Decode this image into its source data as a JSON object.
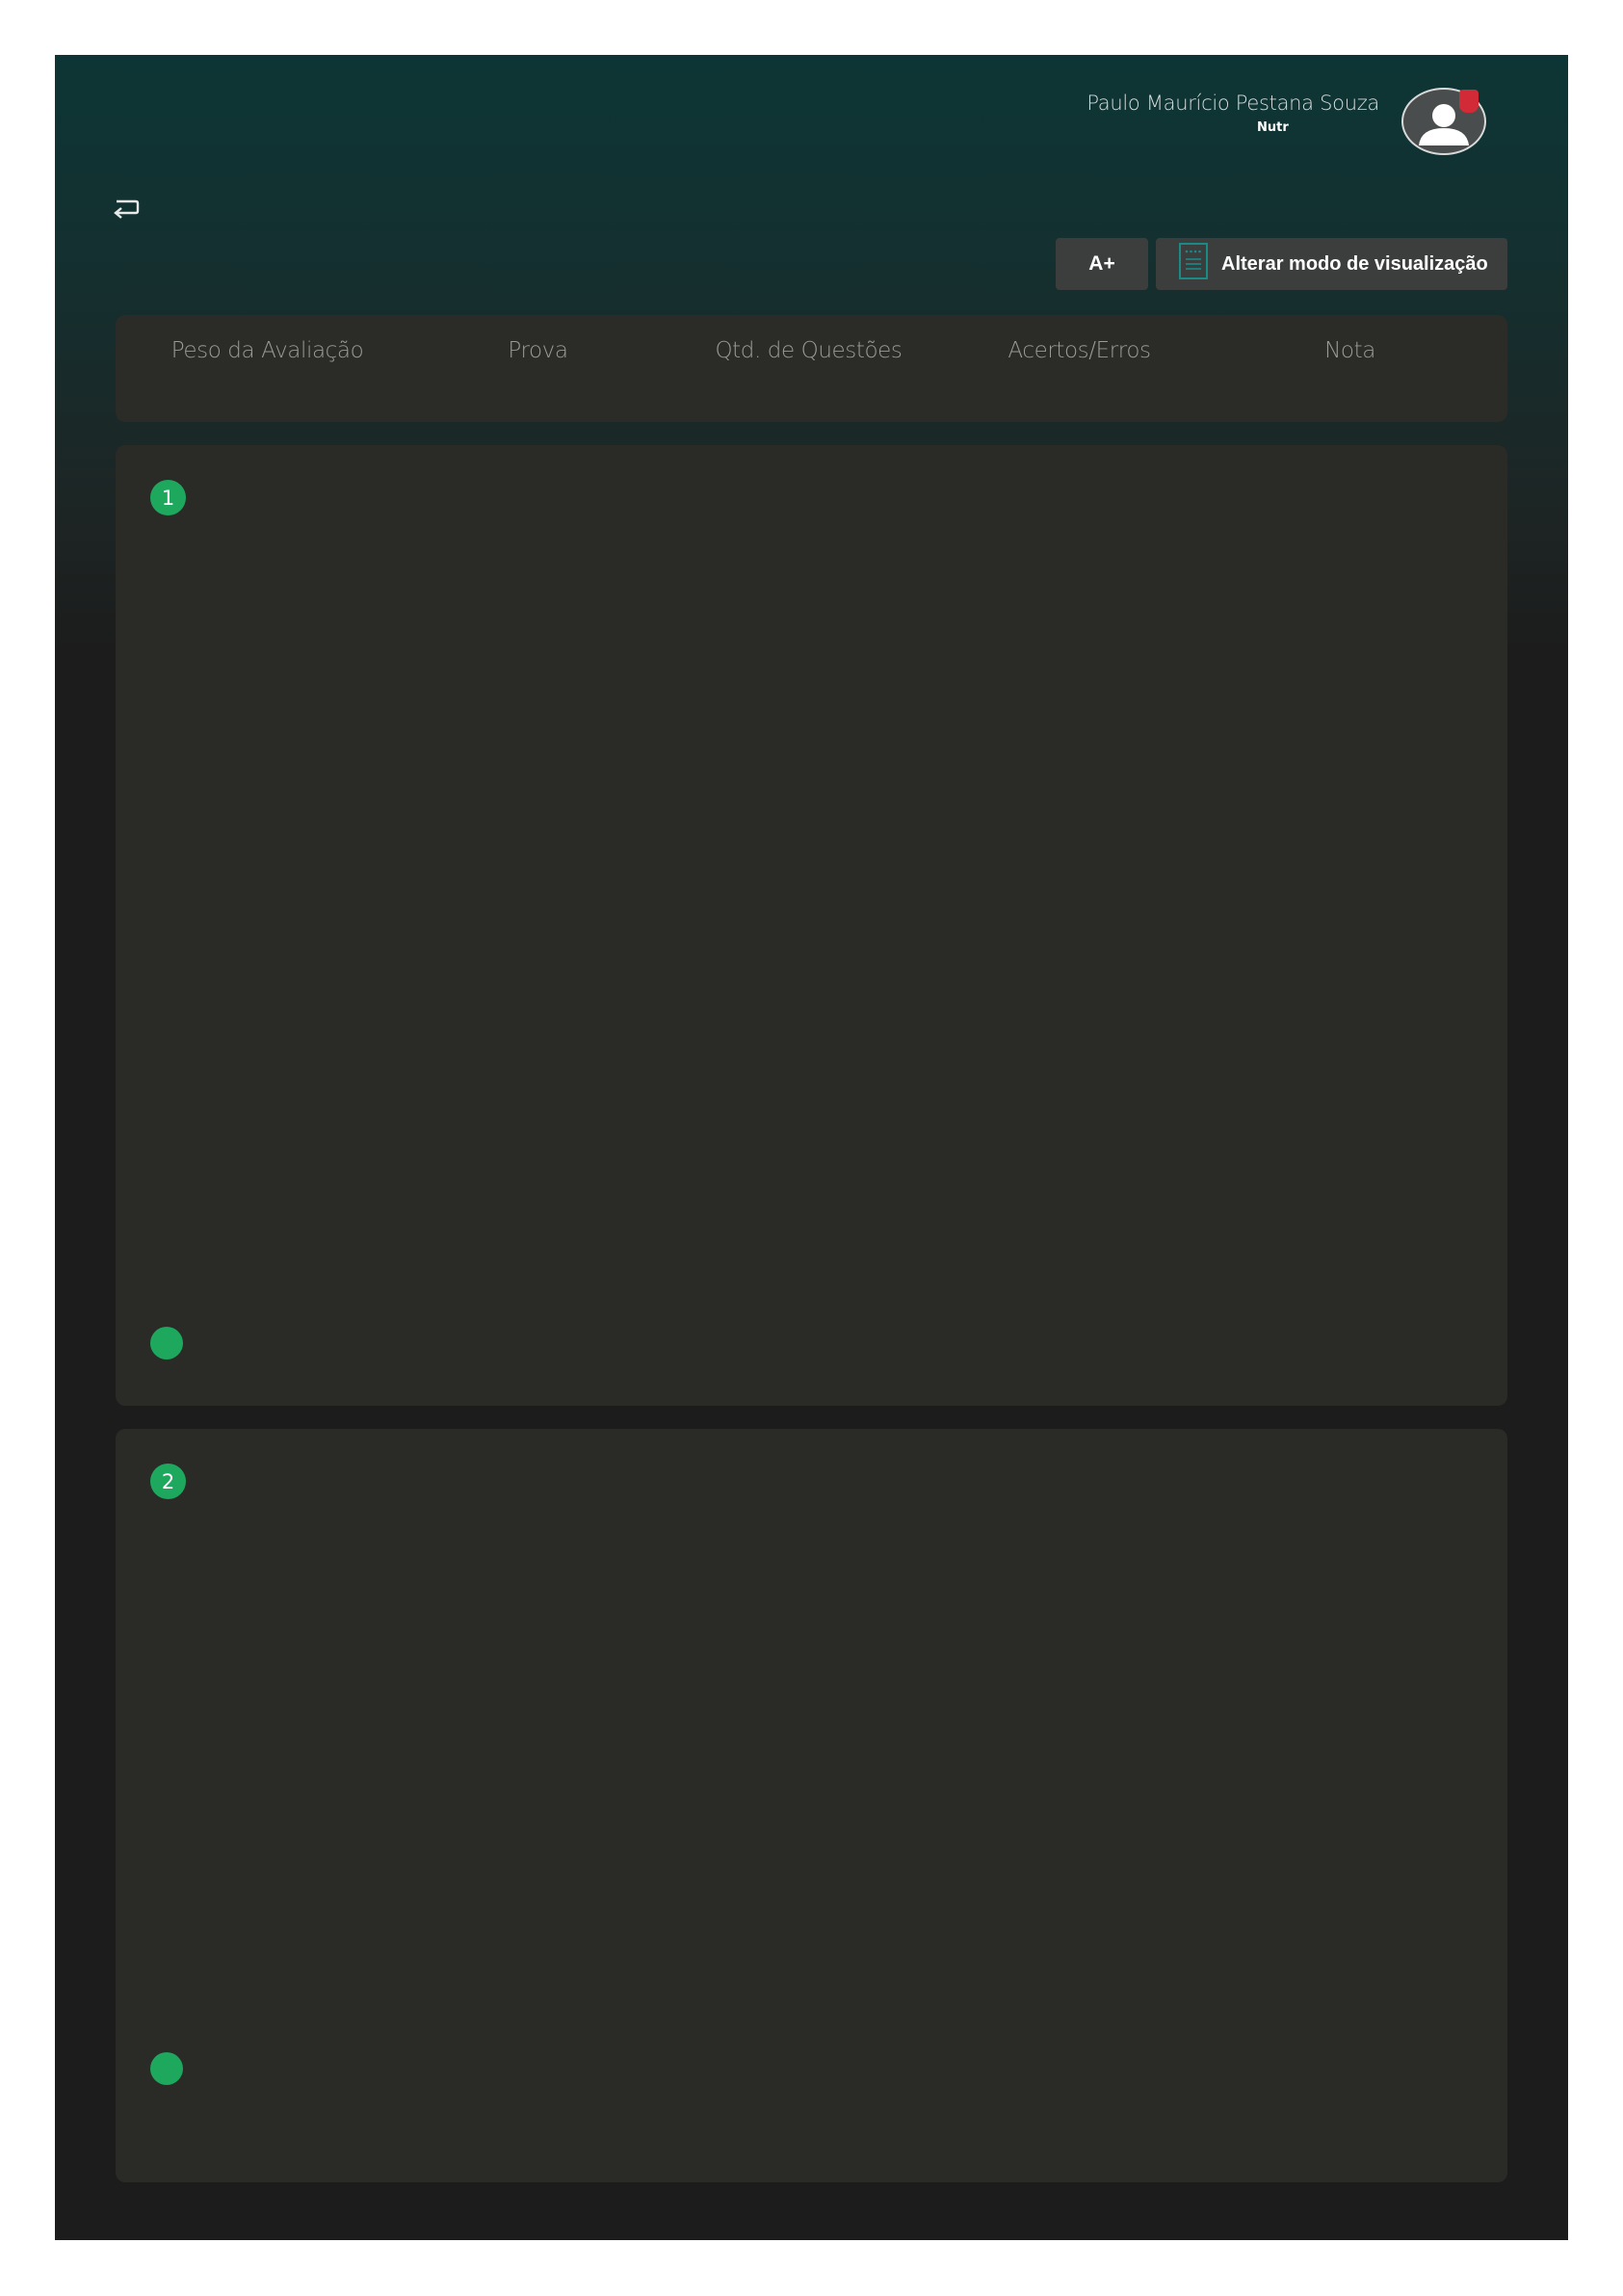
{
  "header": {
    "user_name": "Paulo Maurício Pestana Souza",
    "user_role": "Nutr"
  },
  "icons": {
    "back": "return-arrow-icon",
    "avatar": "user-avatar-icon",
    "notification": "notification-badge-icon",
    "view_mode": "document-icon"
  },
  "toolbar": {
    "font_size_label": "A+",
    "view_mode_label": "Alterar modo de visualização"
  },
  "table_header": {
    "columns": [
      "Peso da Avaliação",
      "Prova",
      "Qtd. de Questões",
      "Acertos/Erros",
      "Nota"
    ]
  },
  "questions": [
    {
      "number": "1"
    },
    {
      "number": "2"
    }
  ],
  "colors": {
    "accent_green": "#1ea85e",
    "header_teal": "#0d3535",
    "card_bg": "#2b2b28",
    "notification_red": "#d22a37"
  }
}
